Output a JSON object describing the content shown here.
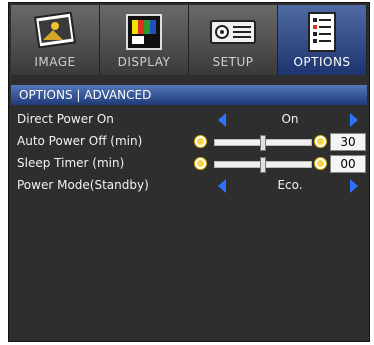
{
  "tabs": [
    {
      "label": "IMAGE",
      "icon": "image-icon"
    },
    {
      "label": "DISPLAY",
      "icon": "display-icon"
    },
    {
      "label": "SETUP",
      "icon": "projector-icon"
    },
    {
      "label": "OPTIONS",
      "icon": "checklist-icon",
      "active": true
    }
  ],
  "section_title": "OPTIONS | ADVANCED",
  "rows": {
    "direct_power_on": {
      "label": "Direct Power On",
      "value": "On"
    },
    "auto_power_off": {
      "label": "Auto Power Off (min)",
      "value": "30",
      "slider_fraction": 0.5
    },
    "sleep_timer": {
      "label": "Sleep Timer (min)",
      "value": "00",
      "slider_fraction": 0.5
    },
    "power_mode": {
      "label": "Power Mode(Standby)",
      "value": "Eco."
    }
  },
  "colors": {
    "accent": "#2c73ff",
    "active_tab": "#2e4a8c",
    "background": "#2e2e2e"
  }
}
